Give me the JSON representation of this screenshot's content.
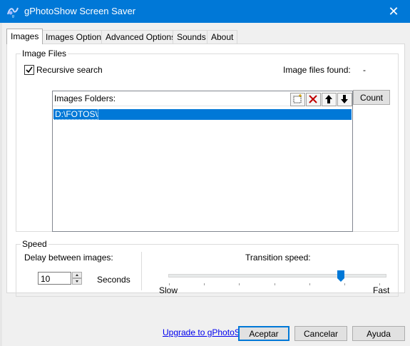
{
  "window": {
    "title": "gPhotoShow Screen Saver",
    "app_icon": "gphotoshow-logo-icon",
    "close_glyph": "✕",
    "accent_color": "#0078d7"
  },
  "tabs": [
    {
      "label": "Images",
      "active": true
    },
    {
      "label": "Images Options",
      "active": false
    },
    {
      "label": "Advanced Options",
      "active": false
    },
    {
      "label": "Sounds",
      "active": false
    },
    {
      "label": "About",
      "active": false
    }
  ],
  "image_files": {
    "group_label": "Image Files",
    "recursive_label": "Recursive search",
    "recursive_checked": true,
    "found_label": "Image files found:",
    "found_value": "-",
    "count_button": "Count",
    "folders_header": "Images Folders:",
    "folders": [
      "D:\\FOTOS\\"
    ],
    "toolbar_icons": [
      "add-folder-icon",
      "delete-icon",
      "move-up-icon",
      "move-down-icon"
    ]
  },
  "speed": {
    "group_label": "Speed",
    "delay_label": "Delay between images:",
    "delay_value": "10",
    "delay_unit": "Seconds",
    "transition_label": "Transition speed:",
    "slow_label": "Slow",
    "fast_label": "Fast",
    "transition_level": 0.8
  },
  "upgrade_link": "Upgrade to gPhotoShow Pro !",
  "buttons": {
    "ok": "Aceptar",
    "cancel": "Cancelar",
    "help": "Ayuda"
  }
}
